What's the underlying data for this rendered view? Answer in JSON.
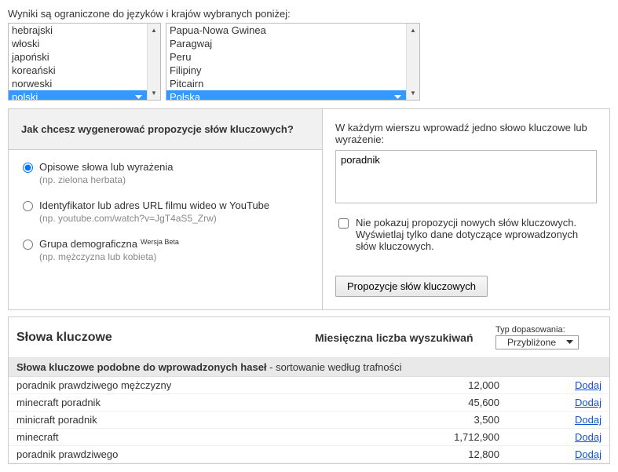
{
  "topLabel": "Wyniki są ograniczone do języków i krajów wybranych poniżej:",
  "languages": {
    "items": [
      "hebrajski",
      "włoski",
      "japoński",
      "koreański",
      "norweski"
    ],
    "selected": "polski"
  },
  "countries": {
    "items": [
      "Papua-Nowa Gwinea",
      "Paragwaj",
      "Peru",
      "Filipiny",
      "Pitcairn"
    ],
    "selected": "Polska"
  },
  "left": {
    "heading": "Jak chcesz wygenerować propozycje słów kluczowych?",
    "opt1": "Opisowe słowa lub wyrażenia",
    "opt1hint": "(np. zielona herbata)",
    "opt2": "Identyfikator lub adres URL filmu wideo w YouTube",
    "opt2hint": "(np. youtube.com/watch?v=JgT4aS5_Zrw)",
    "opt3": "Grupa demograficzna",
    "opt3beta": "Wersja Beta",
    "opt3hint": "(np. mężczyzna lub kobieta)"
  },
  "right": {
    "label": "W każdym wierszu wprowadź jedno słowo kluczowe lub wyrażenie:",
    "textareaValue": "poradnik",
    "checkboxLabel": "Nie pokazuj propozycji nowych słów kluczowych. Wyświetlaj tylko dane dotyczące wprowadzonych słów kluczowych.",
    "submit": "Propozycje słów kluczowych"
  },
  "results": {
    "colKeywords": "Słowa kluczowe",
    "colSearches": "Miesięczna liczba wyszukiwań",
    "matchTypeLabel": "Typ dopasowania:",
    "matchTypeValue": "Przybliżone",
    "subheaderBold": "Słowa kluczowe podobne do wprowadzonych haseł",
    "subheaderRest": " - sortowanie według trafności",
    "addLabel": "Dodaj",
    "rows": [
      {
        "kw": "poradnik prawdziwego mężczyzny",
        "count": "12,000"
      },
      {
        "kw": "minecraft poradnik",
        "count": "45,600"
      },
      {
        "kw": "minicraft poradnik",
        "count": "3,500"
      },
      {
        "kw": "minecraft",
        "count": "1,712,900"
      },
      {
        "kw": "poradnik prawdziwego",
        "count": "12,800"
      }
    ]
  }
}
